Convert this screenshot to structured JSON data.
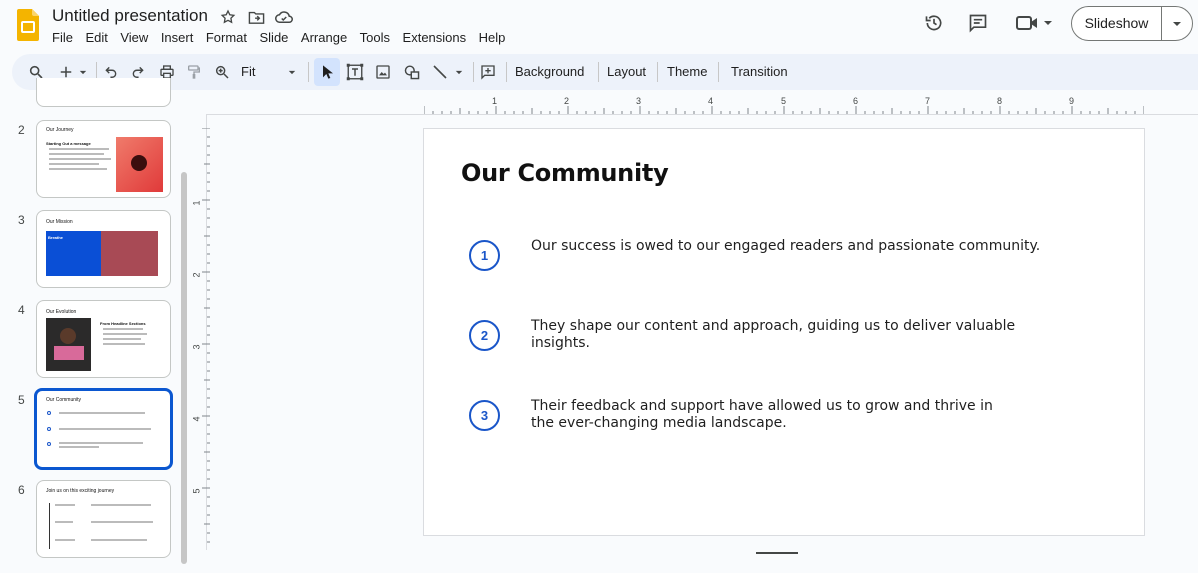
{
  "doc": {
    "title": "Untitled presentation",
    "menu": [
      "File",
      "Edit",
      "View",
      "Insert",
      "Format",
      "Slide",
      "Arrange",
      "Tools",
      "Extensions",
      "Help"
    ]
  },
  "header": {
    "slideshow_label": "Slideshow"
  },
  "toolbar": {
    "zoom_label": "Fit",
    "background_label": "Background",
    "layout_label": "Layout",
    "theme_label": "Theme",
    "transition_label": "Transition"
  },
  "rulers": {
    "horizontal": [
      "1",
      "2",
      "3",
      "4",
      "5",
      "6",
      "7",
      "8",
      "9"
    ],
    "vertical": [
      "1",
      "2",
      "3",
      "4",
      "5"
    ]
  },
  "filmstrip": {
    "slides": [
      {
        "num": "2",
        "title": "Our Journey",
        "subtitle": "Starting Out a message"
      },
      {
        "num": "3",
        "title": "Our Mission",
        "subtitle": "Breathe"
      },
      {
        "num": "4",
        "title": "Our Evolution",
        "subtitle": "From Headline Sections"
      },
      {
        "num": "5",
        "title": "Our Community"
      },
      {
        "num": "6",
        "title": "Join us on this exciting journey"
      }
    ]
  },
  "slide": {
    "title": "Our Community",
    "points": [
      {
        "num": "1",
        "text": "Our success is owed to our engaged readers and passionate community."
      },
      {
        "num": "2",
        "text": "They shape our content and approach, guiding us to deliver valuable insights."
      },
      {
        "num": "3",
        "text": "Their feedback and support have allowed us to grow and thrive in the ever-changing media landscape."
      }
    ]
  },
  "colors": {
    "accent": "#0b57d0",
    "circle": "#1a56c9",
    "logo": "#f4b400",
    "mission_blue": "#0a4fd6",
    "mission_red": "#a84a55"
  }
}
